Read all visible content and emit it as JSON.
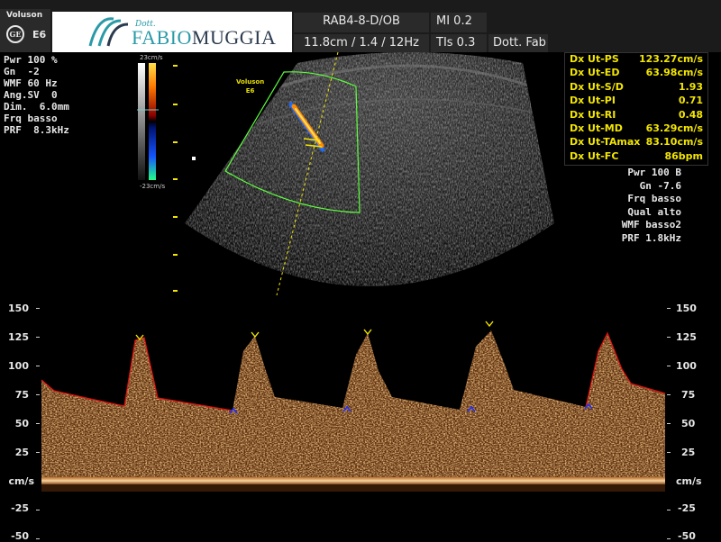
{
  "header": {
    "brand": "Voluson",
    "model": "E6",
    "logo_prefix": "Dott.",
    "logo_name_part1": "FABIO",
    "logo_name_part2": "MUGGIA",
    "probe": "RAB4-8-D/OB",
    "mi": "MI  0.2",
    "depth_info": "11.8cm / 1.4 / 12Hz",
    "tis": "TIs  0.3",
    "operator": "Dott. Fab"
  },
  "left_params": [
    "Pwr 100 %",
    "Gn  -2",
    "WMF 60 Hz",
    "Ang.SV  0",
    "Dim.  6.0mm",
    "Frq basso",
    "PRF  8.3kHz"
  ],
  "colorbar": {
    "top": "23cm/s",
    "bottom": "-23cm/s"
  },
  "image_label": {
    "line1": "Voluson",
    "line2": "E6"
  },
  "measurements": [
    {
      "label": "Dx Ut-PS",
      "value": "123.27cm/s"
    },
    {
      "label": "Dx Ut-ED",
      "value": "63.98cm/s"
    },
    {
      "label": "Dx Ut-S/D",
      "value": "1.93"
    },
    {
      "label": "Dx Ut-PI",
      "value": "0.71"
    },
    {
      "label": "Dx Ut-RI",
      "value": "0.48"
    },
    {
      "label": "Dx Ut-MD",
      "value": "63.29cm/s"
    },
    {
      "label": "Dx Ut-TAmax",
      "value": "83.10cm/s"
    },
    {
      "label": "Dx Ut-FC",
      "value": "86bpm"
    }
  ],
  "right_params": [
    "Pwr 100 B",
    "Gn -7.6",
    "Frq basso",
    "Qual alto",
    "WMF basso2",
    "PRF  1.8kHz"
  ],
  "axis": {
    "ticks": [
      "150",
      "125",
      "100",
      "75",
      "50",
      "25",
      "cm/s",
      "-25",
      "-50"
    ],
    "unit": "cm/s"
  },
  "colors": {
    "doppler_trace": "#e01010",
    "marker_peak": "#f2e500",
    "marker_trough": "#2030ff",
    "measure_text": "#f2e500"
  }
}
